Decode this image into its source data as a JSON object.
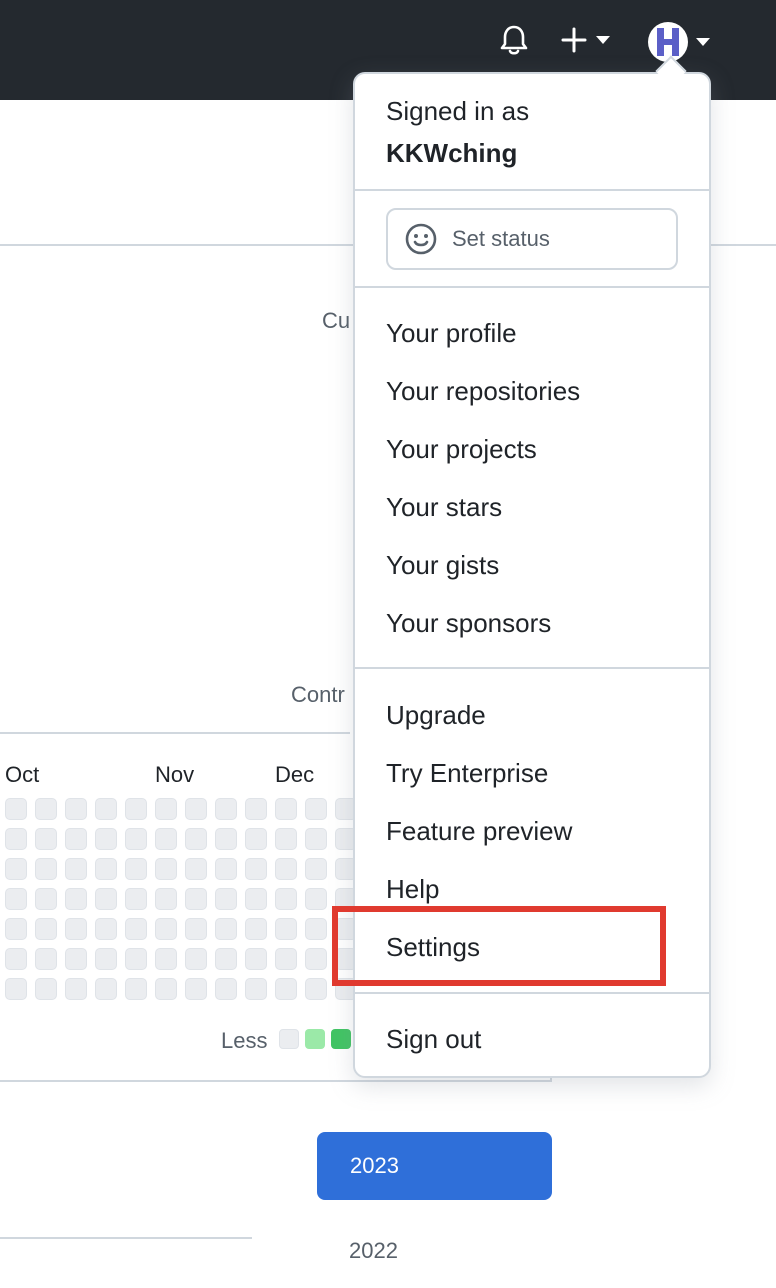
{
  "header": {
    "icons": [
      "bell-icon",
      "plus-icon",
      "avatar"
    ]
  },
  "background": {
    "partial_text_1": "Cu",
    "partial_text_2": "Contr",
    "months": [
      "Oct",
      "Nov",
      "Dec"
    ],
    "legend_less": "Less",
    "year_selected": "2023",
    "year_other": "2022"
  },
  "dropdown": {
    "signed_in_label": "Signed in as",
    "username": "KKWching",
    "set_status_label": "Set status",
    "group1": [
      "Your profile",
      "Your repositories",
      "Your projects",
      "Your stars",
      "Your gists",
      "Your sponsors"
    ],
    "group2": [
      "Upgrade",
      "Try Enterprise",
      "Feature preview",
      "Help",
      "Settings"
    ],
    "sign_out": "Sign out"
  },
  "colors": {
    "header_bg": "#24292f",
    "highlight": "#e03a2f",
    "year_button": "#2f6fd9",
    "contribution_empty": "#ebedf0",
    "contribution_l1": "#9be9a8",
    "contribution_l2": "#40c463"
  }
}
